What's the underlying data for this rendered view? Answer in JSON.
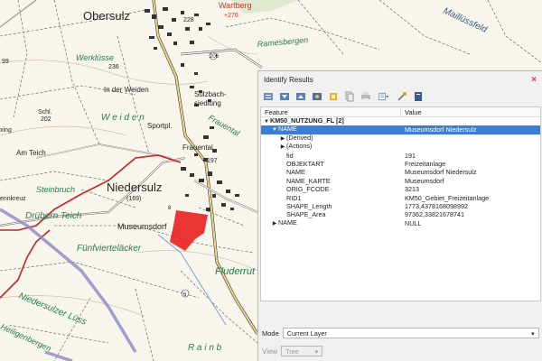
{
  "map": {
    "labels": {
      "obersulz": "Obersulz",
      "wartberg": "Wartberg",
      "wartberg_height": "+276",
      "maillussfeld": "Maillüssfeld",
      "ramesbergen": "Ramesbergen",
      "werklusse": "Werklüsse",
      "in_der_weiden": "In der Weiden",
      "weiden": "W e i d e n",
      "sulzbach": "Sulzbach-",
      "siedlung": "siedlung",
      "frauental": "Frauental",
      "frauental_it": "Frauental",
      "sportpl": "Sportpl.",
      "schl": "Schl.",
      "schl_num": "202",
      "am_teich": "Am Teich",
      "xing": "xing",
      "num_99": "99",
      "niedersulz": "Niedersulz",
      "niedersulz_num": "(169)",
      "steinbruch": "Steinbruch",
      "ennkreuz": "ennkreuz",
      "druebern_teich": "Drübern Teich",
      "museumsdorf": "Museumsdorf",
      "fuenfviertel": "Fünfvierteläcker",
      "fluderrut": "Fluderrut",
      "niedersulzer": "Niedersulzer Lüss",
      "heiligenbergen": "Heiligenbergen",
      "rainb": "R a i n b",
      "num_236": "236",
      "num_228": "228",
      "num_197": "197",
      "num_206": "206",
      "num_6": "6",
      "num_8": "8"
    }
  },
  "panel": {
    "title": "Identify Results",
    "close_icon": "×",
    "toolbar_icons": [
      "expand-all-icon",
      "collapse-all-icon",
      "expand-new-icon",
      "clear-icon",
      "highlight-icon",
      "copy-icon",
      "print-icon",
      "form-icon",
      "settings-icon",
      "help-icon"
    ],
    "columns": {
      "feature": "Feature",
      "value": "Value"
    },
    "rows": [
      {
        "indent": 0,
        "arrow": "▼",
        "feature": "KM50_NUTZUNG_FL [2]",
        "value": "",
        "bold": true,
        "selected": false
      },
      {
        "indent": 1,
        "arrow": "▼",
        "feature": "NAME",
        "value": "Museumsdorf Niedersulz",
        "bold": false,
        "selected": true
      },
      {
        "indent": 2,
        "arrow": "▶",
        "feature": "(Derived)",
        "value": "",
        "bold": false,
        "selected": false
      },
      {
        "indent": 2,
        "arrow": "▶",
        "feature": "(Actions)",
        "value": "",
        "bold": false,
        "selected": false
      },
      {
        "indent": 2,
        "arrow": "",
        "feature": "fid",
        "value": "191",
        "bold": false,
        "selected": false
      },
      {
        "indent": 2,
        "arrow": "",
        "feature": "OBJEKTART",
        "value": "Freizeitanlage",
        "bold": false,
        "selected": false
      },
      {
        "indent": 2,
        "arrow": "",
        "feature": "NAME",
        "value": "Museumsdorf Niedersulz",
        "bold": false,
        "selected": false
      },
      {
        "indent": 2,
        "arrow": "",
        "feature": "NAME_KARTE",
        "value": "Museumsdorf",
        "bold": false,
        "selected": false
      },
      {
        "indent": 2,
        "arrow": "",
        "feature": "ORIG_FCODE",
        "value": "3213",
        "bold": false,
        "selected": false
      },
      {
        "indent": 2,
        "arrow": "",
        "feature": "RID1",
        "value": "KM50_Gebiet_Freizeitanlage",
        "bold": false,
        "selected": false
      },
      {
        "indent": 2,
        "arrow": "",
        "feature": "SHAPE_Length",
        "value": "1773,4378168098992",
        "bold": false,
        "selected": false
      },
      {
        "indent": 2,
        "arrow": "",
        "feature": "SHAPE_Area",
        "value": "97362,33821678741",
        "bold": false,
        "selected": false
      },
      {
        "indent": 1,
        "arrow": "▶",
        "feature": "NAME",
        "value": "NULL",
        "bold": false,
        "selected": false
      }
    ],
    "mode": {
      "label": "Mode",
      "value": "Current Layer"
    },
    "view": {
      "label": "View",
      "value": "Tree"
    }
  }
}
